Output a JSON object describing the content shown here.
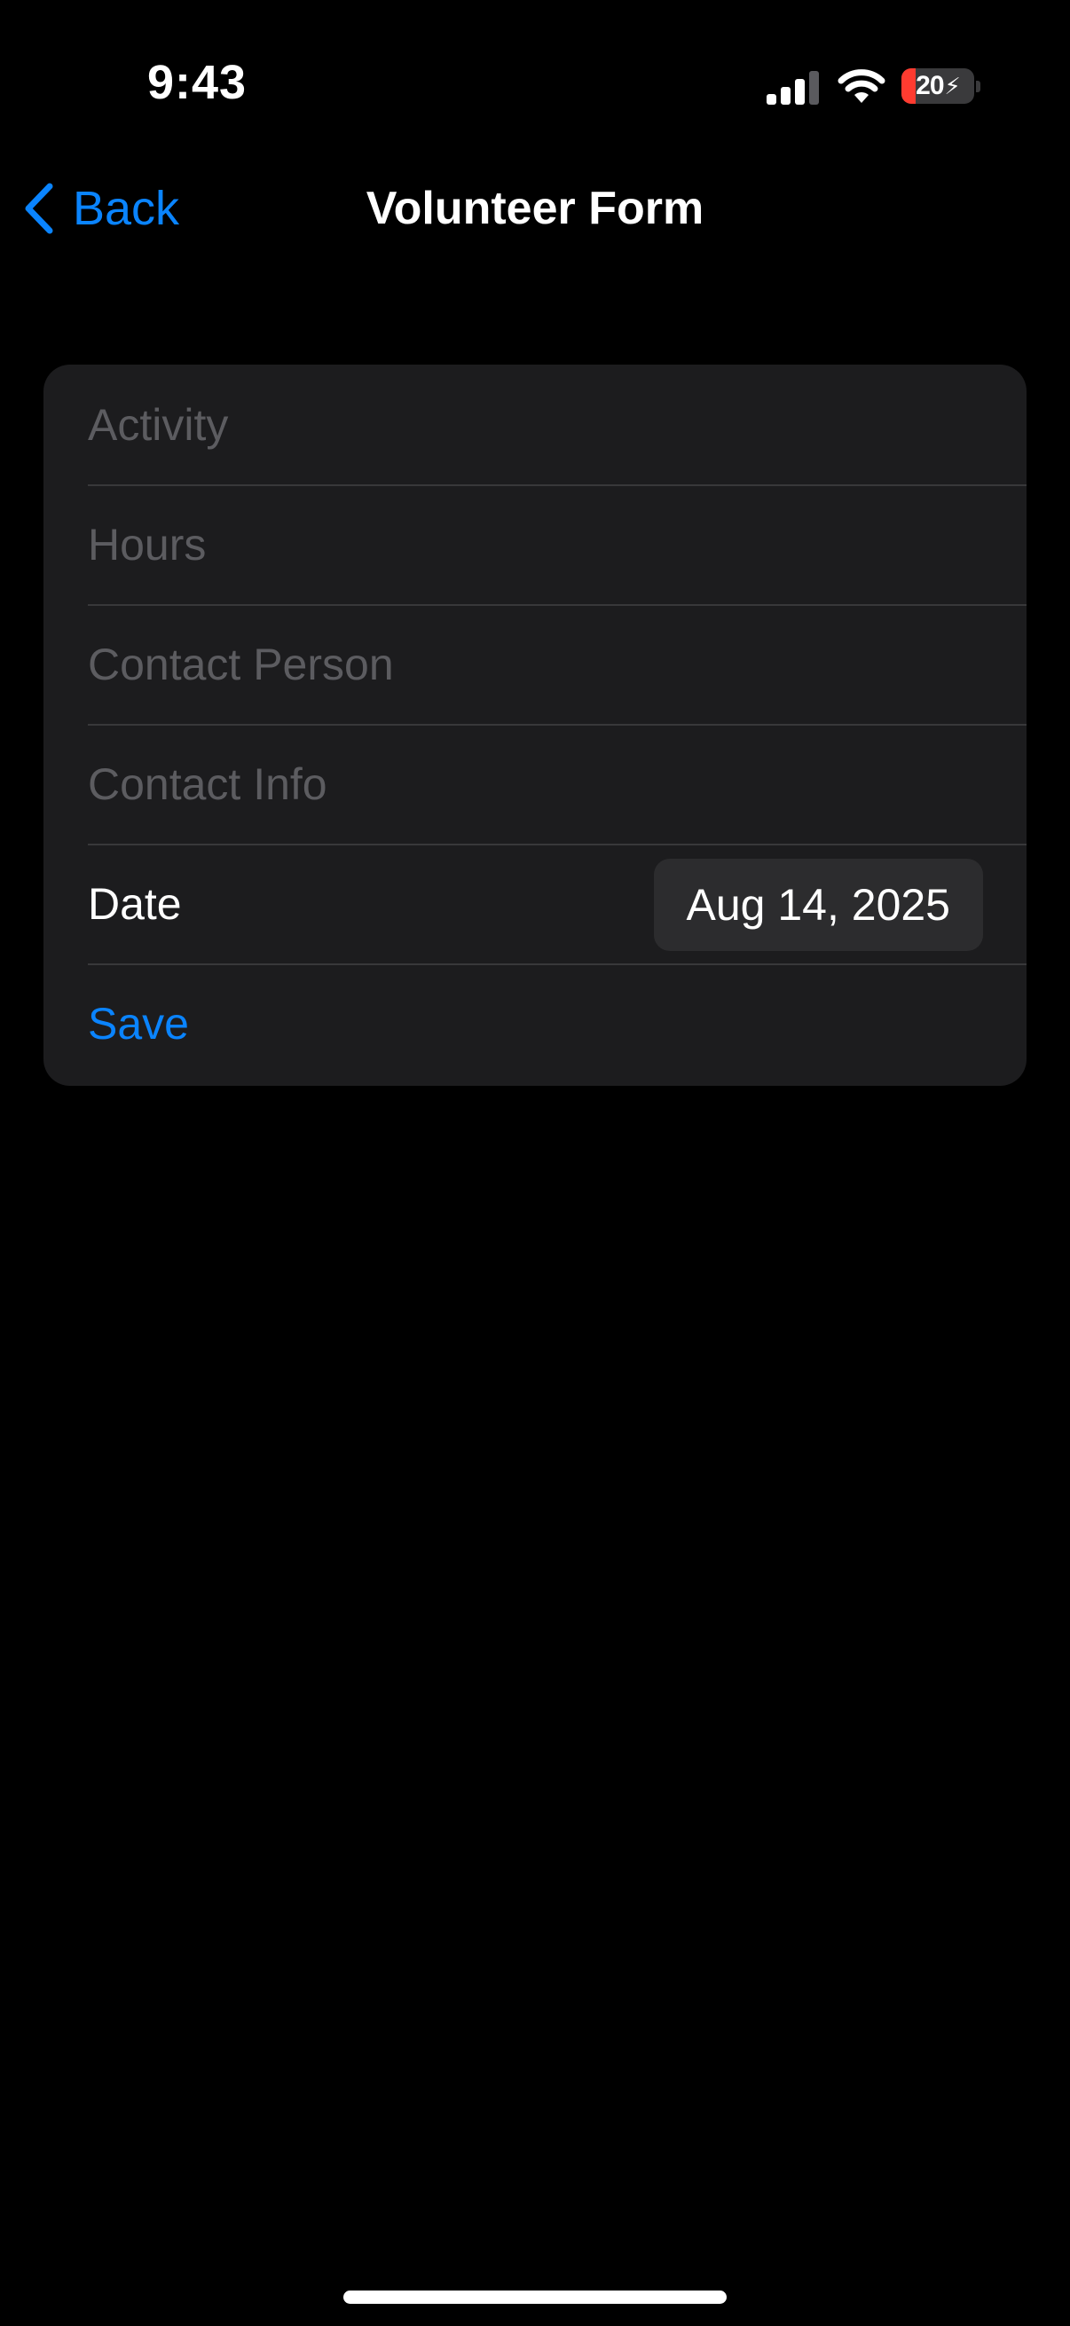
{
  "status_bar": {
    "time": "9:43",
    "battery_level": "20",
    "battery_fill_fraction": 0.2,
    "battery_color": "#ff3b30",
    "icons": [
      "cellular-signal-icon",
      "wifi-icon",
      "battery-charging-icon"
    ]
  },
  "nav": {
    "back_label": "Back",
    "title": "Volunteer Form",
    "accent_color": "#0a84ff"
  },
  "form": {
    "fields": [
      {
        "name": "activity",
        "placeholder": "Activity",
        "value": ""
      },
      {
        "name": "hours",
        "placeholder": "Hours",
        "value": ""
      },
      {
        "name": "contact-person",
        "placeholder": "Contact Person",
        "value": ""
      },
      {
        "name": "contact-info",
        "placeholder": "Contact Info",
        "value": ""
      }
    ],
    "date_label": "Date",
    "date_value": "Aug 14, 2025",
    "save_label": "Save"
  }
}
